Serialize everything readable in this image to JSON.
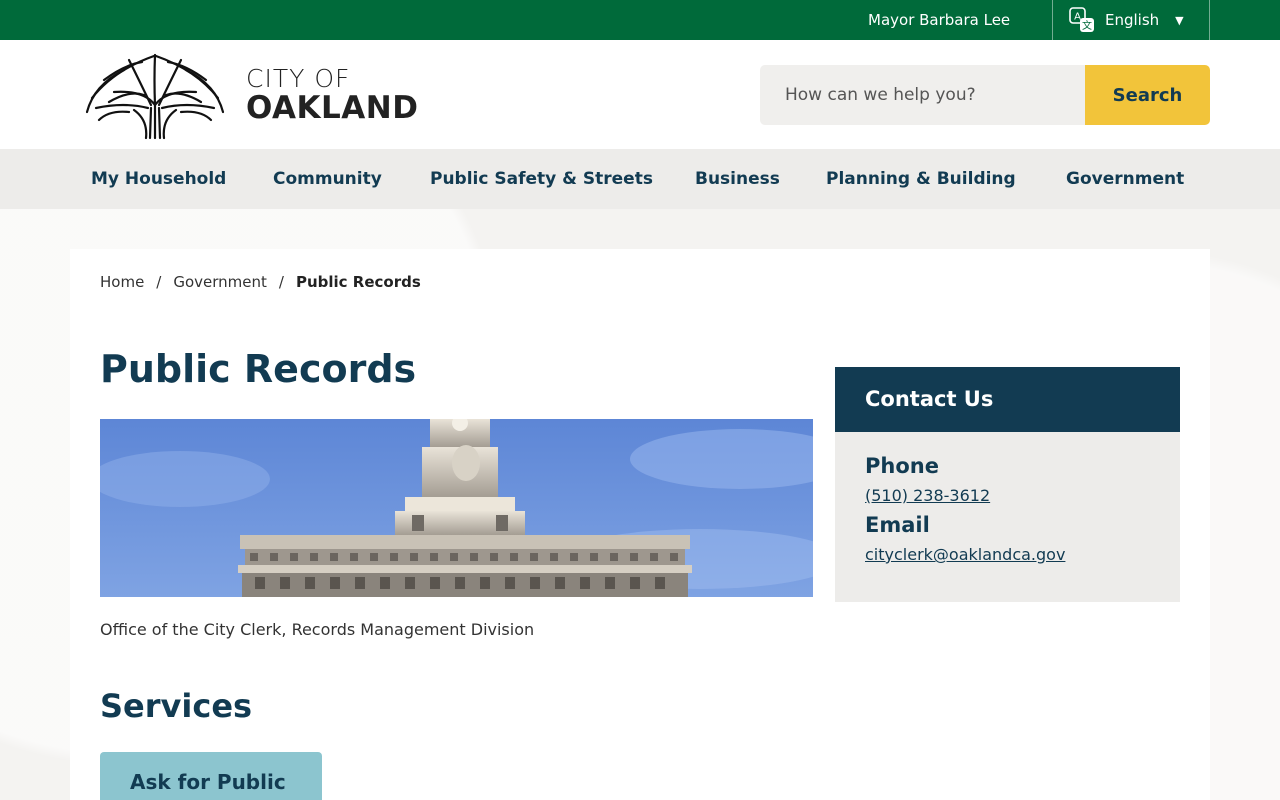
{
  "topbar": {
    "mayor_link": "Mayor Barbara Lee",
    "language": "English"
  },
  "header": {
    "logo_line1": "CITY OF",
    "logo_line2": "OAKLAND",
    "search_placeholder": "How can we help you?",
    "search_button": "Search"
  },
  "nav": {
    "items": [
      "My Household",
      "Community",
      "Public Safety & Streets",
      "Business",
      "Planning & Building",
      "Government"
    ]
  },
  "breadcrumb": {
    "home": "Home",
    "sep": "/",
    "parent": "Government",
    "current": "Public Records"
  },
  "page": {
    "title": "Public Records",
    "caption": "Office of the City Clerk, Records Management Division",
    "services_heading": "Services",
    "service_card": "Ask for Public"
  },
  "contact": {
    "title": "Contact Us",
    "phone_label": "Phone",
    "phone": "(510) 238-3612",
    "email_label": "Email",
    "email": "cityclerk@oaklandca.gov"
  },
  "colors": {
    "topbar": "#006a3a",
    "navy": "#123b52",
    "search_button": "#f2c43a",
    "service_card": "#8cc5cf"
  }
}
